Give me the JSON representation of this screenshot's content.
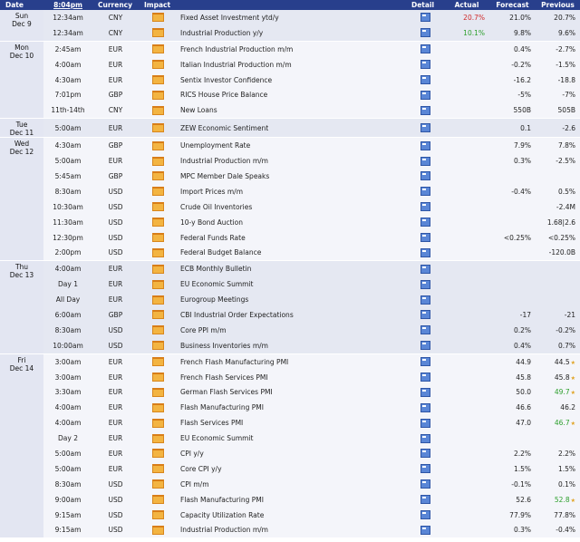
{
  "header": {
    "date": "Date",
    "time": "8:04pm",
    "currency": "Currency",
    "impact": "Impact",
    "detail": "Detail",
    "actual": "Actual",
    "forecast": "Forecast",
    "previous": "Previous"
  },
  "rows": [
    {
      "d1": "Sun",
      "d2": "Dec 9",
      "time": "12:34am",
      "cur": "CNY",
      "event": "Fixed Asset Investment ytd/y",
      "actual": "20.7%",
      "actual_color": "red",
      "forecast": "21.0%",
      "previous": "20.7%"
    },
    {
      "time": "12:34am",
      "cur": "CNY",
      "event": "Industrial Production y/y",
      "actual": "10.1%",
      "actual_color": "green",
      "forecast": "9.8%",
      "previous": "9.6%"
    },
    {
      "d1": "Mon",
      "d2": "Dec 10",
      "time": "2:45am",
      "cur": "EUR",
      "event": "French Industrial Production m/m",
      "actual": "",
      "forecast": "0.4%",
      "previous": "-2.7%"
    },
    {
      "time": "4:00am",
      "cur": "EUR",
      "event": "Italian Industrial Production m/m",
      "actual": "",
      "forecast": "-0.2%",
      "previous": "-1.5%"
    },
    {
      "time": "4:30am",
      "cur": "EUR",
      "event": "Sentix Investor Confidence",
      "actual": "",
      "forecast": "-16.2",
      "previous": "-18.8"
    },
    {
      "time": "7:01pm",
      "cur": "GBP",
      "event": "RICS House Price Balance",
      "actual": "",
      "forecast": "-5%",
      "previous": "-7%"
    },
    {
      "time": "11th-14th",
      "cur": "CNY",
      "event": "New Loans",
      "actual": "",
      "forecast": "550B",
      "previous": "505B"
    },
    {
      "d1": "Tue",
      "d2": "Dec 11",
      "time": "5:00am",
      "cur": "EUR",
      "event": "ZEW Economic Sentiment",
      "actual": "",
      "forecast": "0.1",
      "previous": "-2.6"
    },
    {
      "d1": "Wed",
      "d2": "Dec 12",
      "time": "4:30am",
      "cur": "GBP",
      "event": "Unemployment Rate",
      "actual": "",
      "forecast": "7.9%",
      "previous": "7.8%"
    },
    {
      "time": "5:00am",
      "cur": "EUR",
      "event": "Industrial Production m/m",
      "actual": "",
      "forecast": "0.3%",
      "previous": "-2.5%"
    },
    {
      "time": "5:45am",
      "cur": "GBP",
      "event": "MPC Member Dale Speaks",
      "actual": "",
      "forecast": "",
      "previous": ""
    },
    {
      "time": "8:30am",
      "cur": "USD",
      "event": "Import Prices m/m",
      "actual": "",
      "forecast": "-0.4%",
      "previous": "0.5%"
    },
    {
      "time": "10:30am",
      "cur": "USD",
      "event": "Crude Oil Inventories",
      "actual": "",
      "forecast": "",
      "previous": "-2.4M"
    },
    {
      "time": "11:30am",
      "cur": "USD",
      "event": "10-y Bond Auction",
      "actual": "",
      "forecast": "",
      "previous": "1.68|2.6"
    },
    {
      "time": "12:30pm",
      "cur": "USD",
      "event": "Federal Funds Rate",
      "actual": "",
      "forecast": "<0.25%",
      "previous": "<0.25%"
    },
    {
      "time": "2:00pm",
      "cur": "USD",
      "event": "Federal Budget Balance",
      "actual": "",
      "forecast": "",
      "previous": "-120.0B"
    },
    {
      "d1": "Thu",
      "d2": "Dec 13",
      "time": "4:00am",
      "cur": "EUR",
      "event": "ECB Monthly Bulletin",
      "actual": "",
      "forecast": "",
      "previous": ""
    },
    {
      "time": "Day 1",
      "cur": "EUR",
      "event": "EU Economic Summit",
      "actual": "",
      "forecast": "",
      "previous": ""
    },
    {
      "time": "All Day",
      "cur": "EUR",
      "event": "Eurogroup Meetings",
      "actual": "",
      "forecast": "",
      "previous": ""
    },
    {
      "time": "6:00am",
      "cur": "GBP",
      "event": "CBI Industrial Order Expectations",
      "actual": "",
      "forecast": "-17",
      "previous": "-21"
    },
    {
      "time": "8:30am",
      "cur": "USD",
      "event": "Core PPI m/m",
      "actual": "",
      "forecast": "0.2%",
      "previous": "-0.2%"
    },
    {
      "time": "10:00am",
      "cur": "USD",
      "event": "Business Inventories m/m",
      "actual": "",
      "forecast": "0.4%",
      "previous": "0.7%"
    },
    {
      "d1": "Fri",
      "d2": "Dec 14",
      "time": "3:00am",
      "cur": "EUR",
      "event": "French Flash Manufacturing PMI",
      "actual": "",
      "forecast": "44.9",
      "previous": "44.5",
      "star": true
    },
    {
      "time": "3:00am",
      "cur": "EUR",
      "event": "French Flash Services PMI",
      "actual": "",
      "forecast": "45.8",
      "previous": "45.8",
      "star": true
    },
    {
      "time": "3:30am",
      "cur": "EUR",
      "event": "German Flash Services PMI",
      "actual": "",
      "forecast": "50.0",
      "previous": "49.7",
      "previous_color": "green",
      "star": true
    },
    {
      "time": "4:00am",
      "cur": "EUR",
      "event": "Flash Manufacturing PMI",
      "actual": "",
      "forecast": "46.6",
      "previous": "46.2"
    },
    {
      "time": "4:00am",
      "cur": "EUR",
      "event": "Flash Services PMI",
      "actual": "",
      "forecast": "47.0",
      "previous": "46.7",
      "previous_color": "green",
      "star": true
    },
    {
      "time": "Day 2",
      "cur": "EUR",
      "event": "EU Economic Summit",
      "actual": "",
      "forecast": "",
      "previous": ""
    },
    {
      "time": "5:00am",
      "cur": "EUR",
      "event": "CPI y/y",
      "actual": "",
      "forecast": "2.2%",
      "previous": "2.2%"
    },
    {
      "time": "5:00am",
      "cur": "EUR",
      "event": "Core CPI y/y",
      "actual": "",
      "forecast": "1.5%",
      "previous": "1.5%"
    },
    {
      "time": "8:30am",
      "cur": "USD",
      "event": "CPI m/m",
      "actual": "",
      "forecast": "-0.1%",
      "previous": "0.1%"
    },
    {
      "time": "9:00am",
      "cur": "USD",
      "event": "Flash Manufacturing PMI",
      "actual": "",
      "forecast": "52.6",
      "previous": "52.8",
      "previous_color": "green",
      "star": true
    },
    {
      "time": "9:15am",
      "cur": "USD",
      "event": "Capacity Utilization Rate",
      "actual": "",
      "forecast": "77.9%",
      "previous": "77.8%"
    },
    {
      "time": "9:15am",
      "cur": "USD",
      "event": "Industrial Production m/m",
      "actual": "",
      "forecast": "0.3%",
      "previous": "-0.4%"
    }
  ],
  "day_groups": [
    {
      "start": 0,
      "span": 2,
      "shade": "even"
    },
    {
      "start": 2,
      "span": 5,
      "shade": "odd"
    },
    {
      "start": 7,
      "span": 1,
      "shade": "even"
    },
    {
      "start": 8,
      "span": 8,
      "shade": "odd"
    },
    {
      "start": 16,
      "span": 6,
      "shade": "even"
    },
    {
      "start": 22,
      "span": 12,
      "shade": "odd"
    }
  ]
}
